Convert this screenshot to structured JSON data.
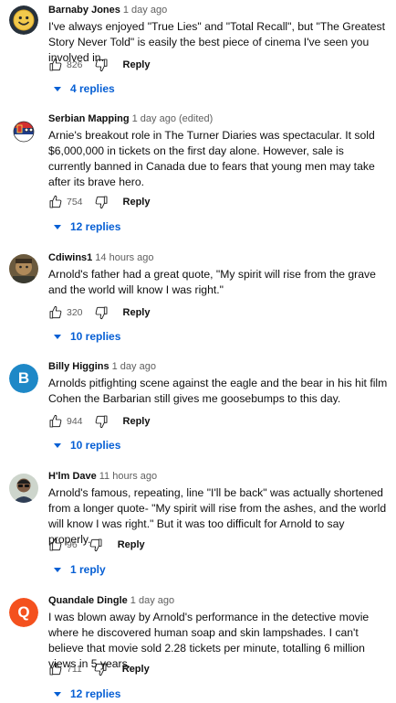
{
  "comments": [
    {
      "author": "Barnaby Jones",
      "time": "1 day ago",
      "text": "I've always enjoyed \"True Lies\" and \"Total Recall\", but \"The Greatest Story Never Told\" is easily the best piece of cinema I've seen you involved in.",
      "likes": "826",
      "reply_label": "Reply",
      "replies_label": "4 replies",
      "avatar_icon": "smiley-avatar-icon"
    },
    {
      "author": "Serbian Mapping",
      "time": "1 day ago (edited)",
      "text": "Arnie's breakout role in The Turner Diaries was spectacular. It sold $6,000,000 in tickets on the first day alone. However, sale is currently banned in Canada due to fears that young men may take after its brave hero.",
      "likes": "754",
      "reply_label": "Reply",
      "replies_label": "12 replies",
      "avatar_icon": "flag-ball-avatar-icon"
    },
    {
      "author": "Cdiwins1",
      "time": "14 hours ago",
      "text": "Arnold's father had a great quote, \"My spirit will rise from the grave and the world will know I was right.\"",
      "likes": "320",
      "reply_label": "Reply",
      "replies_label": "10 replies",
      "avatar_icon": "photo-avatar-icon"
    },
    {
      "author": "Billy Higgins",
      "time": "1 day ago",
      "text": "Arnolds pitfighting scene against the eagle and the bear in his hit film Cohen the Barbarian still gives me goosebumps to this day.",
      "likes": "944",
      "reply_label": "Reply",
      "replies_label": "10 replies",
      "avatar_letter": "B",
      "avatar_color": "#1e88c7"
    },
    {
      "author": "H'lm Dave",
      "time": "11 hours ago",
      "text": "Arnold's famous, repeating, line \"I'll be back\" was actually shortened from a longer quote- \"My spirit will rise from the ashes, and the world will know I was right.\" But it was too difficult for Arnold to say properly.",
      "likes": "96",
      "reply_label": "Reply",
      "replies_label": "1 reply",
      "avatar_icon": "person-avatar-icon"
    },
    {
      "author": "Quandale Dingle",
      "time": "1 day ago",
      "text": "I was blown away by Arnold's performance in the detective movie where he discovered human soap and skin lampshades. I can't believe that movie sold 2.28 tickets per minute, totalling 6 million views in 5 years.",
      "likes": "711",
      "reply_label": "Reply",
      "replies_label": "12 replies",
      "avatar_letter": "Q",
      "avatar_color": "#f4511e"
    }
  ],
  "colors": {
    "link_blue": "#065fd4",
    "secondary_text": "#606060"
  }
}
